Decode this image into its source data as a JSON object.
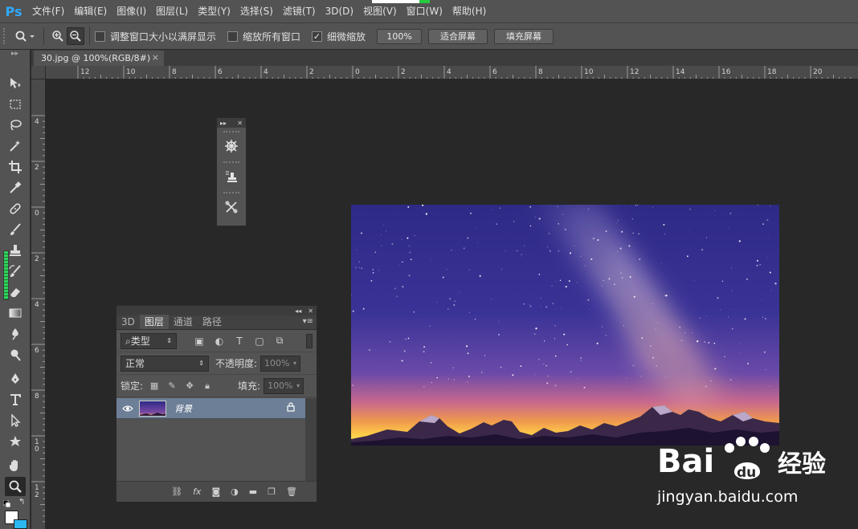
{
  "app": {
    "logo": "Ps"
  },
  "menu": [
    "文件(F)",
    "编辑(E)",
    "图像(I)",
    "图层(L)",
    "类型(Y)",
    "选择(S)",
    "滤镜(T)",
    "3D(D)",
    "视图(V)",
    "窗口(W)",
    "帮助(H)"
  ],
  "options": {
    "resize_windows": "调整窗口大小以满屏显示",
    "zoom_all": "缩放所有窗口",
    "scrubby_zoom": "细微缩放",
    "btn_100": "100%",
    "btn_fit": "适合屏幕",
    "btn_fill": "填充屏幕",
    "resize_checked": false,
    "zoom_all_checked": false,
    "scrubby_checked": true
  },
  "document": {
    "tab_title": "30.jpg @ 100%(RGB/8#)",
    "tab_close": "×"
  },
  "ruler": {
    "h_labels": [
      "12",
      "10",
      "8",
      "6",
      "4",
      "2",
      "0",
      "2",
      "4",
      "6",
      "8",
      "10",
      "12",
      "14",
      "16",
      "18",
      "20"
    ],
    "v_labels": [
      "4",
      "2",
      "0",
      "2",
      "4",
      "6",
      "8",
      "1\n0",
      "1\n2"
    ]
  },
  "layers_panel": {
    "tabs": [
      "3D",
      "图层",
      "通道",
      "路径"
    ],
    "active_tab": "图层",
    "filter_kind": "类型",
    "blend_mode": "正常",
    "opacity_label": "不透明度:",
    "opacity_value": "100%",
    "lock_label": "锁定:",
    "fill_label": "填充:",
    "fill_value": "100%",
    "layer_name": "背景"
  },
  "watermark": {
    "brand": "Bai du 经验",
    "url": "jingyan.baidu.com"
  },
  "colors": {
    "foreground": "#ffffff",
    "background": "#2bb8f0",
    "accent": "#31a8ff"
  }
}
